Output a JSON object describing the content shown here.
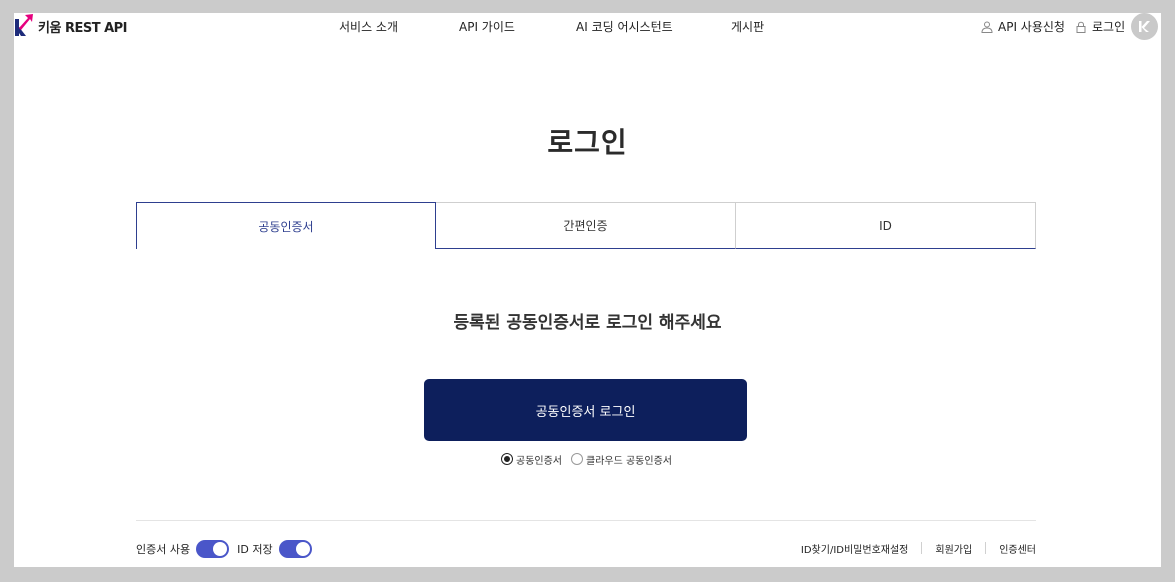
{
  "header": {
    "logo_text": "키움 REST API",
    "nav": [
      "서비스 소개",
      "API 가이드",
      "AI 코딩 어시스턴트",
      "게시판"
    ],
    "api_apply_label": "API 사용신청",
    "login_label": "로그인"
  },
  "page_title": "로그인",
  "tabs": [
    "공동인증서",
    "간편인증",
    "ID"
  ],
  "active_tab": "공동인증서",
  "subtitle": "등록된 공동인증서로 로그인 해주세요",
  "login_button_label": "공동인증서 로그인",
  "cert_options": [
    {
      "label": "공동인증서",
      "selected": true
    },
    {
      "label": "클라우드 공동인증서",
      "selected": false
    }
  ],
  "toggles": [
    {
      "label": "인증서 사용",
      "on": true
    },
    {
      "label": "ID 저장",
      "on": true
    }
  ],
  "footer_links": [
    "ID찾기/ID비밀번호재설정",
    "회원가입",
    "인증센터"
  ],
  "colors": {
    "primary_navy": "#0d1f5c",
    "tab_active": "#2e3f8f",
    "toggle_on": "#4a56c9",
    "logo_pink": "#e6007e",
    "logo_navy": "#1d2b7a"
  }
}
